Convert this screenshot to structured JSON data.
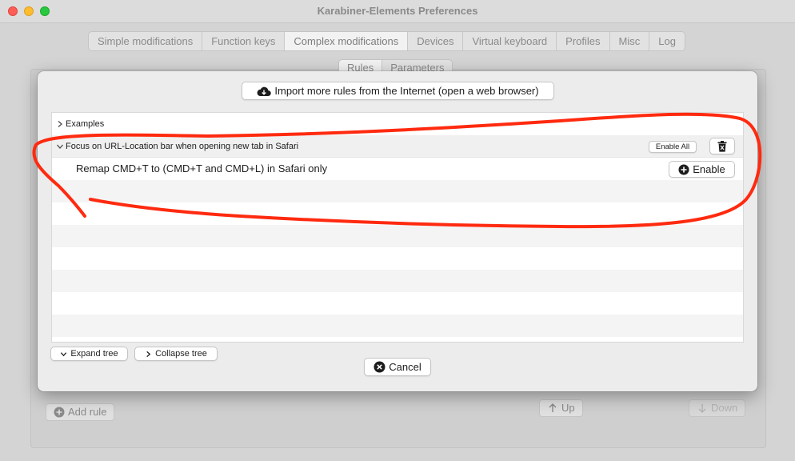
{
  "window": {
    "title": "Karabiner-Elements Preferences"
  },
  "tabs": [
    {
      "label": "Simple modifications",
      "active": false
    },
    {
      "label": "Function keys",
      "active": false
    },
    {
      "label": "Complex modifications",
      "active": true
    },
    {
      "label": "Devices",
      "active": false
    },
    {
      "label": "Virtual keyboard",
      "active": false
    },
    {
      "label": "Profiles",
      "active": false
    },
    {
      "label": "Misc",
      "active": false
    },
    {
      "label": "Log",
      "active": false
    }
  ],
  "subtabs": [
    {
      "label": "Rules",
      "active": true
    },
    {
      "label": "Parameters",
      "active": false
    }
  ],
  "background": {
    "add_rule_label": "Add rule",
    "up_label": "Up",
    "down_label": "Down"
  },
  "sheet": {
    "import_label": "Import more rules from the Internet (open a web browser)",
    "examples_label": "Examples",
    "group_label": "Focus on URL-Location bar when opening new tab in Safari",
    "enable_all_label": "Enable All",
    "rule_label": "Remap CMD+T to (CMD+T and CMD+L) in Safari only",
    "enable_label": "Enable",
    "expand_label": "Expand tree",
    "collapse_label": "Collapse tree",
    "cancel_label": "Cancel"
  },
  "colors": {
    "annotation": "#ff2a0f",
    "window_bg": "#d4d4d4",
    "sheet_bg": "#ececec"
  }
}
